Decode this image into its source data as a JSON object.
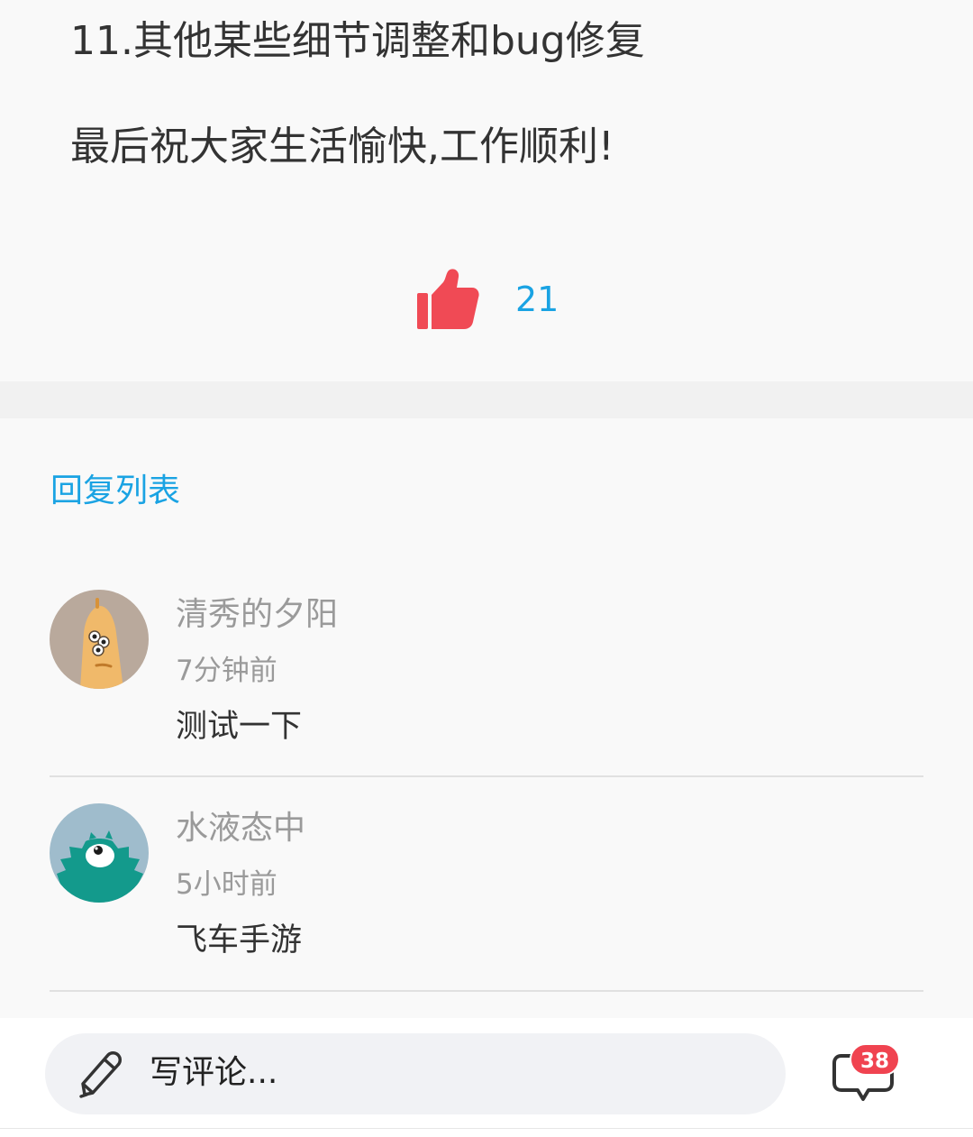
{
  "article": {
    "lines": [
      "11.其他某些细节调整和bug修复",
      "最后祝大家生活愉快,工作顺利!"
    ],
    "like_count": "21",
    "like_icon": "thumbs-up-icon",
    "like_color": "#f04a55",
    "accent_color": "#1aa3e3"
  },
  "replies": {
    "title": "回复列表",
    "items": [
      {
        "user": "清秀的夕阳",
        "time": "7分钟前",
        "text": "测试一下",
        "avatar": "orange-three-eyed-monster-avatar"
      },
      {
        "user": "水液态中",
        "time": "5小时前",
        "text": "飞车手游",
        "avatar": "teal-one-eyed-monster-avatar"
      }
    ]
  },
  "bottom_bar": {
    "placeholder": "写评论...",
    "comment_count": "38",
    "edit_icon": "pencil-icon",
    "comments_icon": "chat-bubble-icon",
    "badge_color": "#f04350"
  }
}
